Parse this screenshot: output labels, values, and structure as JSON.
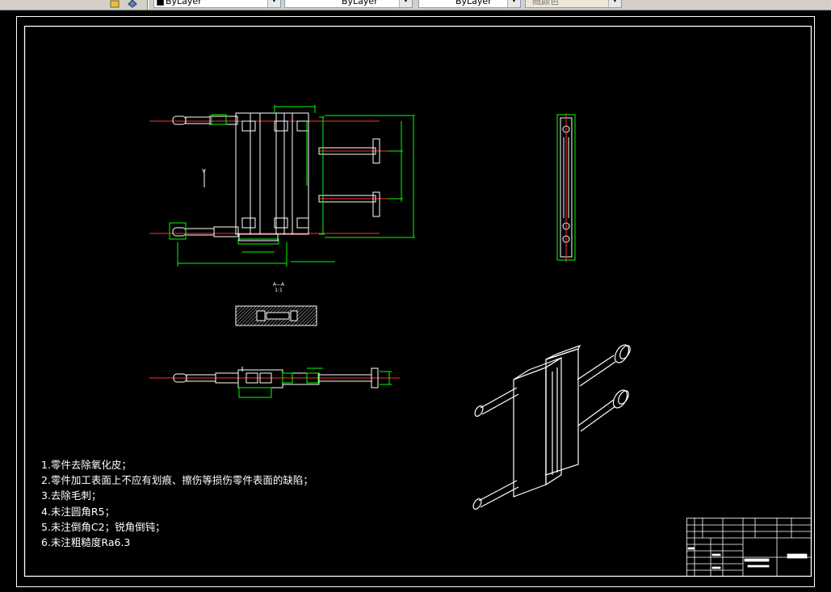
{
  "toolbar": {
    "color_combo": {
      "value": "ByLayer"
    },
    "linetype_combo": {
      "value": "ByLayer"
    },
    "lineweight_combo": {
      "value": "ByLayer"
    },
    "plotstyle_combo": {
      "value": "随颜色"
    }
  },
  "drawing": {
    "section_label": "A—A",
    "section_scale": "1:1",
    "technical_notes": [
      "1.零件去除氧化皮；",
      "2.零件加工表面上不应有划痕、擦伤等损伤零件表面的缺陷；",
      "3.去除毛刺；",
      "4.未注圆角R5；",
      "5.未注倒角C2；锐角倒钝；",
      "6.未注粗糙度Ra6.3"
    ]
  },
  "colors": {
    "background": "#000000",
    "geometry": "#ffffff",
    "dimension": "#00ff00",
    "centerline": "#ff0000",
    "toolbar": "#d4d0c8"
  }
}
